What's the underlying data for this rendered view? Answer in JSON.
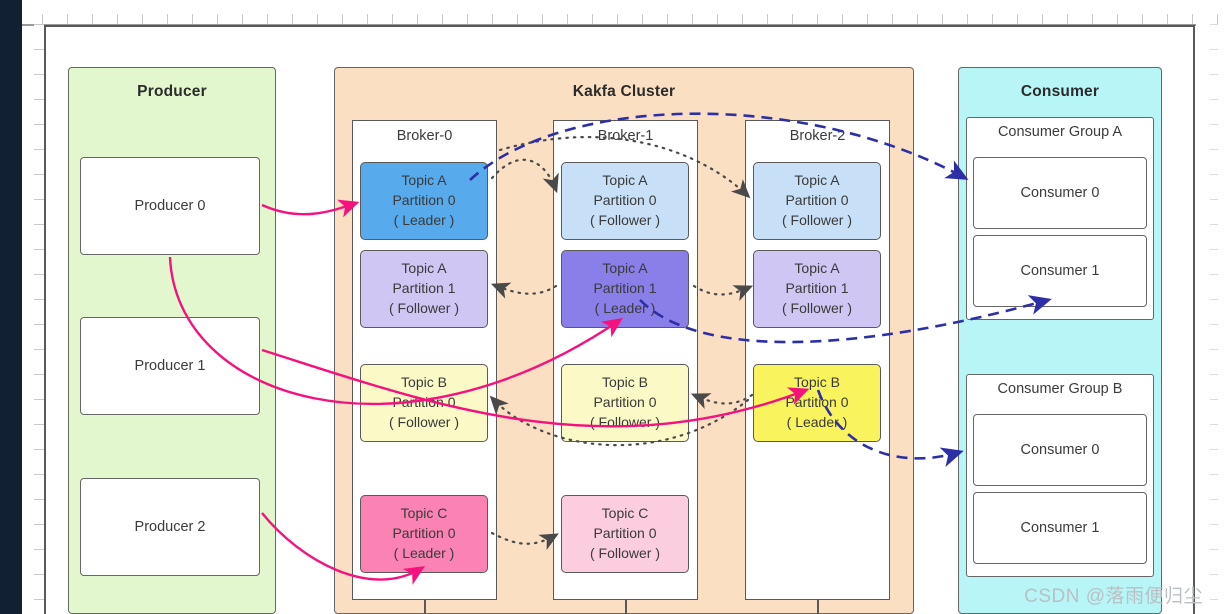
{
  "panels": {
    "producer": {
      "title": "Producer",
      "bg": "#e2f7cd"
    },
    "cluster": {
      "title": "Kakfa Cluster",
      "bg": "#fbdfc3"
    },
    "consumer": {
      "title": "Consumer",
      "bg": "#b7f5f7"
    }
  },
  "producers": [
    {
      "label": "Producer 0"
    },
    {
      "label": "Producer 1"
    },
    {
      "label": "Producer 2"
    }
  ],
  "brokers": [
    {
      "label": "Broker-0",
      "partitions": [
        {
          "topic": "Topic A",
          "partition": "Partition 0",
          "role": "( Leader )",
          "color": "#57aaec"
        },
        {
          "topic": "Topic A",
          "partition": "Partition 1",
          "role": "( Follower )",
          "color": "#cfc6f4"
        },
        {
          "topic": "Topic B",
          "partition": "Partition 0",
          "role": "( Follower )",
          "color": "#fbf9c6"
        },
        {
          "topic": "Topic C",
          "partition": "Partition 0",
          "role": "( Leader )",
          "color": "#fa83b4"
        }
      ]
    },
    {
      "label": "Broker-1",
      "partitions": [
        {
          "topic": "Topic A",
          "partition": "Partition 0",
          "role": "( Follower )",
          "color": "#c8e0f7"
        },
        {
          "topic": "Topic A",
          "partition": "Partition 1",
          "role": "( Leader )",
          "color": "#8a7ee8"
        },
        {
          "topic": "Topic B",
          "partition": "Partition 0",
          "role": "( Follower )",
          "color": "#fbf9c6"
        },
        {
          "topic": "Topic C",
          "partition": "Partition 0",
          "role": "( Follower )",
          "color": "#fbcddf"
        }
      ]
    },
    {
      "label": "Broker-2",
      "partitions": [
        {
          "topic": "Topic A",
          "partition": "Partition 0",
          "role": "( Follower )",
          "color": "#c8e0f7"
        },
        {
          "topic": "Topic A",
          "partition": "Partition 1",
          "role": "( Follower )",
          "color": "#cfc6f4"
        },
        {
          "topic": "Topic B",
          "partition": "Partition 0",
          "role": "( Leader )",
          "color": "#f9f45e"
        }
      ]
    }
  ],
  "consumer_groups": [
    {
      "label": "Consumer Group A",
      "members": [
        "Consumer 0",
        "Consumer 1"
      ]
    },
    {
      "label": "Consumer Group B",
      "members": [
        "Consumer 0",
        "Consumer 1"
      ]
    }
  ],
  "watermark": "CSDN @落雨便归尘",
  "colors": {
    "produce_arrow": "#f5127e",
    "consume_arrow": "#2d2fa6",
    "replicate_arrow": "#4a4a4a",
    "border": "#666666"
  }
}
